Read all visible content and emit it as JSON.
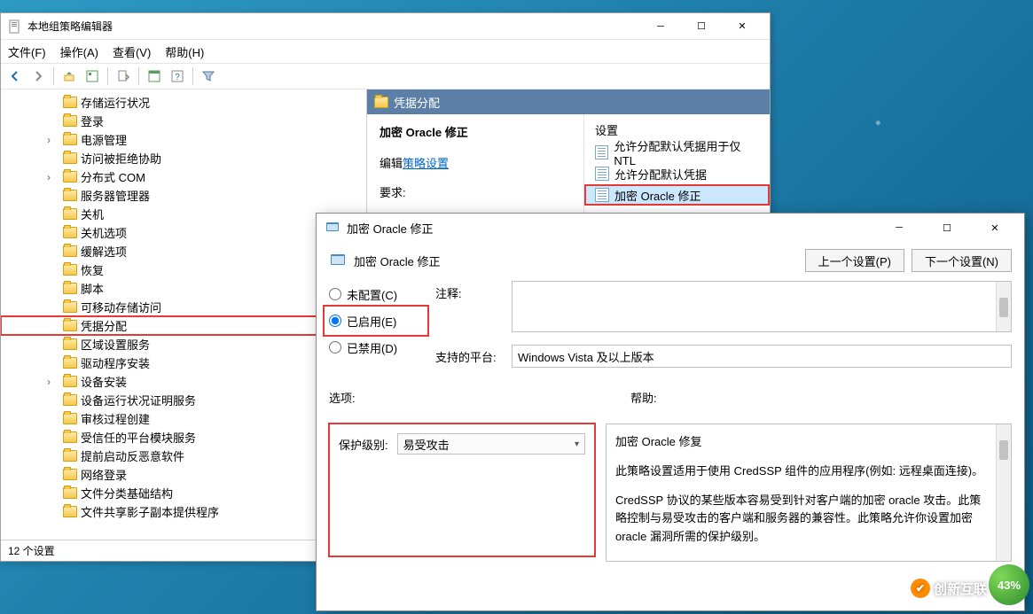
{
  "editor": {
    "title": "本地组策略编辑器",
    "menu": {
      "file": "文件(F)",
      "action": "操作(A)",
      "view": "查看(V)",
      "help": "帮助(H)"
    },
    "status": "12 个设置"
  },
  "tree": {
    "items": [
      {
        "label": "存储运行状况",
        "caret": false
      },
      {
        "label": "登录",
        "caret": false
      },
      {
        "label": "电源管理",
        "caret": true
      },
      {
        "label": "访问被拒绝协助",
        "caret": false
      },
      {
        "label": "分布式 COM",
        "caret": true
      },
      {
        "label": "服务器管理器",
        "caret": false
      },
      {
        "label": "关机",
        "caret": false
      },
      {
        "label": "关机选项",
        "caret": false
      },
      {
        "label": "缓解选项",
        "caret": false
      },
      {
        "label": "恢复",
        "caret": false
      },
      {
        "label": "脚本",
        "caret": false
      },
      {
        "label": "可移动存储访问",
        "caret": false
      },
      {
        "label": "凭据分配",
        "caret": false,
        "hl": true
      },
      {
        "label": "区域设置服务",
        "caret": false
      },
      {
        "label": "驱动程序安装",
        "caret": false
      },
      {
        "label": "设备安装",
        "caret": true
      },
      {
        "label": "设备运行状况证明服务",
        "caret": false
      },
      {
        "label": "审核过程创建",
        "caret": false
      },
      {
        "label": "受信任的平台模块服务",
        "caret": false
      },
      {
        "label": "提前启动反恶意软件",
        "caret": false
      },
      {
        "label": "网络登录",
        "caret": false
      },
      {
        "label": "文件分类基础结构",
        "caret": false
      },
      {
        "label": "文件共享影子副本提供程序",
        "caret": false
      }
    ]
  },
  "content": {
    "header": "凭据分配",
    "desc": {
      "title": "加密 Oracle 修正",
      "edit_prefix": "编辑",
      "edit_link": "策略设置",
      "req_label": "要求:"
    },
    "settings_header": "设置",
    "rows": [
      {
        "label": "允许分配默认凭据用于仅 NTL"
      },
      {
        "label": "允许分配默认凭据"
      },
      {
        "label": "加密 Oracle 修正",
        "hl": true,
        "sel": true
      }
    ]
  },
  "dialog": {
    "title": "加密 Oracle 修正",
    "header": "加密 Oracle 修正",
    "prev_btn": "上一个设置(P)",
    "next_btn": "下一个设置(N)",
    "radios": {
      "not_configured": "未配置(C)",
      "enabled": "已启用(E)",
      "disabled": "已禁用(D)"
    },
    "comment_label": "注释:",
    "platform_label": "支持的平台:",
    "platform_value": "Windows Vista 及以上版本",
    "options_label": "选项:",
    "help_label": "帮助:",
    "level_label": "保护级别:",
    "level_value": "易受攻击",
    "help_text": {
      "p1": "加密 Oracle 修复",
      "p2": "此策略设置适用于使用 CredSSP 组件的应用程序(例如: 远程桌面连接)。",
      "p3": "CredSSP 协议的某些版本容易受到针对客户端的加密 oracle 攻击。此策略控制与易受攻击的客户端和服务器的兼容性。此策略允许你设置加密 oracle 漏洞所需的保护级别。"
    }
  },
  "watermark": {
    "brand": "创新互联",
    "badge": "43%"
  }
}
